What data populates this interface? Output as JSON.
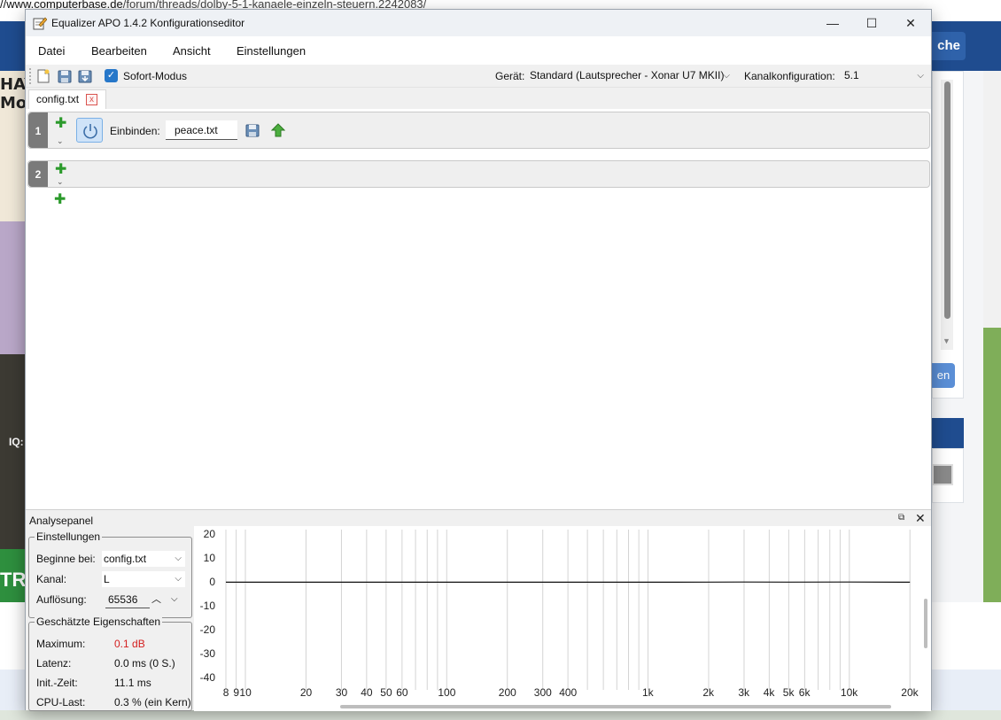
{
  "background": {
    "url_host": "//www.computerbase.de",
    "url_path": "/forum/threads/dolby-5-1-kanaele-einzeln-steuern.2242083/",
    "nav_button": "che",
    "side_button": "en",
    "left_text_1": "HAY",
    "left_text_2": "Mo",
    "left_text_3": "IQ:",
    "left_text_4": "TR"
  },
  "window": {
    "title": "Equalizer APO 1.4.2 Konfigurationseditor",
    "minimize": "—",
    "maximize": "☐",
    "close": "✕"
  },
  "menu": {
    "datei": "Datei",
    "bearbeiten": "Bearbeiten",
    "ansicht": "Ansicht",
    "einstellungen": "Einstellungen"
  },
  "toolbar": {
    "sofort_modus": "Sofort-Modus",
    "sofort_checked": "✓",
    "geraet_label": "Gerät:",
    "geraet_value": "Standard (Lautsprecher - Xonar U7 MKII)",
    "kanal_label": "Kanalkonfiguration:",
    "kanal_value": "5.1",
    "dropdown_arrow": "⌵"
  },
  "tab": {
    "label": "config.txt",
    "close": "x"
  },
  "editor": {
    "row1_number": "1",
    "row2_number": "2",
    "add": "✚",
    "expand": "⌄",
    "einbinden_label": "Einbinden:",
    "einbinden_value": "peace.txt"
  },
  "analysis": {
    "title": "Analysepanel",
    "undock": "⧉",
    "close": "✕",
    "settings_group": "Einstellungen",
    "beginne_label": "Beginne bei:",
    "beginne_value": "config.txt",
    "kanal_label": "Kanal:",
    "kanal_value": "L",
    "aufloesung_label": "Auflösung:",
    "aufloesung_value": "65536",
    "spin_up": "︿",
    "spin_down": "⌵",
    "props_group": "Geschätzte Eigenschaften",
    "maximum_label": "Maximum:",
    "maximum_value": "0.1 dB",
    "maximum_color": "#d42020",
    "latenz_label": "Latenz:",
    "latenz_value": "0.0 ms (0 S.)",
    "init_label": "Init.-Zeit:",
    "init_value": "11.1 ms",
    "cpu_label": "CPU-Last:",
    "cpu_value": "0.3 % (ein Kern)"
  },
  "chart_data": {
    "type": "line",
    "xscale": "log",
    "yticks": [
      "20",
      "10",
      "0",
      "-10",
      "-20",
      "-30",
      "-40"
    ],
    "xticks": [
      "8",
      "9",
      "10",
      "20",
      "30",
      "40",
      "50",
      "60",
      "100",
      "200",
      "300",
      "400",
      "1k",
      "2k",
      "3k",
      "4k",
      "5k",
      "6k",
      "10k",
      "20k"
    ],
    "ylim": [
      -45,
      22
    ],
    "xlim": [
      8,
      23000
    ],
    "series": [
      {
        "x": [
          8,
          20,
          100,
          1000,
          2000,
          3000,
          5000,
          10000,
          20000
        ],
        "y": [
          0,
          0,
          0,
          0,
          0.05,
          0.1,
          0.05,
          0.1,
          0
        ]
      }
    ]
  }
}
